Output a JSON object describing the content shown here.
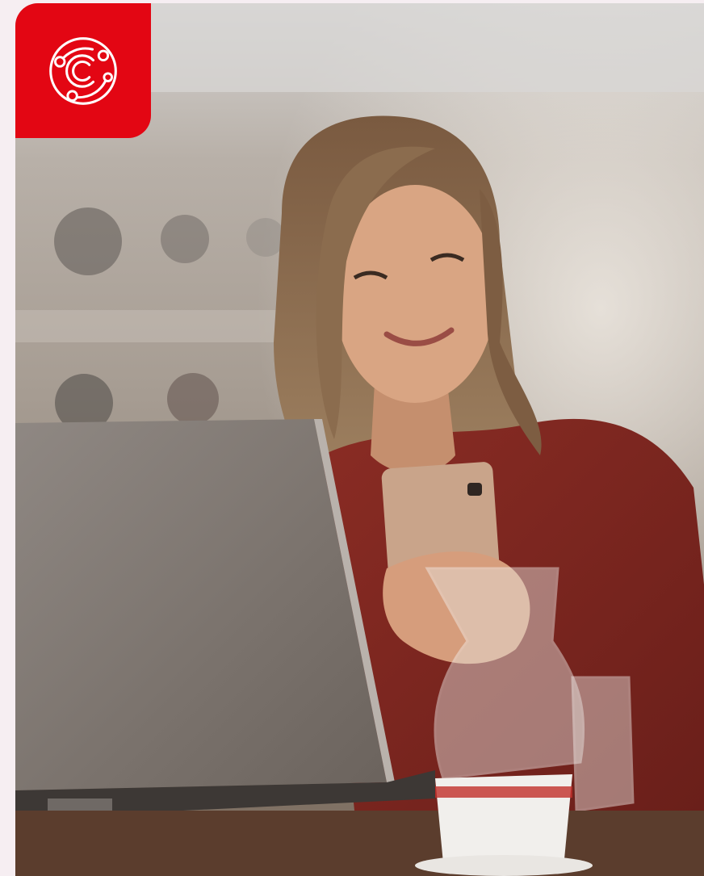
{
  "brand": {
    "badge_color": "#e30613",
    "logo_icon": "orbit-c-logo-icon"
  },
  "hero_image": {
    "subject": "woman-with-phone-and-laptop-photo"
  }
}
